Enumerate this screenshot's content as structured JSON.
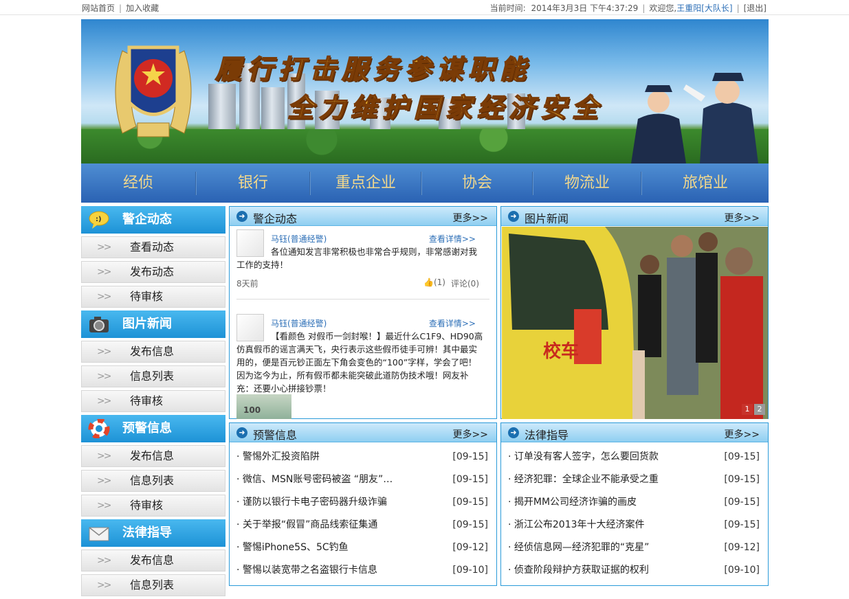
{
  "topbar": {
    "home": "网站首页",
    "bookmark": "加入收藏",
    "time_label": "当前时间:",
    "time": "2014年3月3日 下午4:37:29",
    "welcome": "欢迎您,",
    "user": "王重阳[大队长]",
    "logout": "[退出]"
  },
  "banner": {
    "slogan1": "履行打击服务参谋职能",
    "slogan2": "全力维护国家经济安全"
  },
  "nav": [
    "经侦",
    "银行",
    "重点企业",
    "协会",
    "物流业",
    "旅馆业"
  ],
  "sidebar": [
    {
      "title": "警企动态",
      "icon": "chat-bubble-icon",
      "items": [
        "查看动态",
        "发布动态",
        "待审核"
      ]
    },
    {
      "title": "图片新闻",
      "icon": "camera-icon",
      "items": [
        "发布信息",
        "信息列表",
        "待审核"
      ]
    },
    {
      "title": "预警信息",
      "icon": "lifebuoy-icon",
      "items": [
        "发布信息",
        "信息列表",
        "待审核"
      ]
    },
    {
      "title": "法律指导",
      "icon": "envelope-icon",
      "items": [
        "发布信息",
        "信息列表"
      ]
    }
  ],
  "panels": {
    "dynamics": {
      "title": "警企动态",
      "more": "更多>>",
      "posts": [
        {
          "author": "马钰(普通经警)",
          "detail": "查看详情>>",
          "text": "各位通知发言非常积极也非常合乎规则，非常感谢对我工作的支持！",
          "age": "8天前",
          "likes": "(1)",
          "comments": "评论(0)"
        },
        {
          "author": "马钰(普通经警)",
          "detail": "查看详情>>",
          "text": "【看颜色 对假币一剑封喉！】最近什么C1F9、HD90高仿真假币的谣言满天飞，央行表示这些假币徒手可辨！其中最实用的，便是百元钞正面左下角会变色的“100”字样，学会了吧！因为迄今为止，所有假币都未能突破此道防伪技术哦！网友补充：还要小心拼接钞票！",
          "thumb_text": "100"
        }
      ]
    },
    "photo_news": {
      "title": "图片新闻",
      "more": "更多>>",
      "pages": [
        "1",
        "2"
      ],
      "plate": "校车"
    },
    "warnings": {
      "title": "预警信息",
      "more": "更多>>",
      "items": [
        {
          "t": "· 警惕外汇投资陷阱",
          "d": "[09-15]"
        },
        {
          "t": "· 微信、MSN账号密码被盗 “朋友”…",
          "d": "[09-15]"
        },
        {
          "t": "· 谨防以银行卡电子密码器升级诈骗",
          "d": "[09-15]"
        },
        {
          "t": "· 关于举报“假冒”商品线索征集通",
          "d": "[09-15]"
        },
        {
          "t": "· 警惕iPhone5S、5C钓鱼",
          "d": "[09-12]"
        },
        {
          "t": "· 警惕以装宽带之名盗银行卡信息",
          "d": "[09-10]"
        }
      ]
    },
    "law": {
      "title": "法律指导",
      "more": "更多>>",
      "items": [
        {
          "t": "· 订单没有客人签字，怎么要回货款",
          "d": "[09-15]"
        },
        {
          "t": "· 经济犯罪：全球企业不能承受之重",
          "d": "[09-15]"
        },
        {
          "t": "· 揭开MM公司经济诈骗的画皮",
          "d": "[09-15]"
        },
        {
          "t": "· 浙江公布2013年十大经济案件",
          "d": "[09-15]"
        },
        {
          "t": "· 经侦信息网—经济犯罪的“克星”",
          "d": "[09-12]"
        },
        {
          "t": "· 侦查阶段辩护方获取证据的权利",
          "d": "[09-10]"
        }
      ]
    }
  },
  "colors": {
    "accent": "#1d92d6",
    "nav": "#2a62b3",
    "nav_text": "#f2d88c",
    "pager_active": "#c8332b"
  }
}
